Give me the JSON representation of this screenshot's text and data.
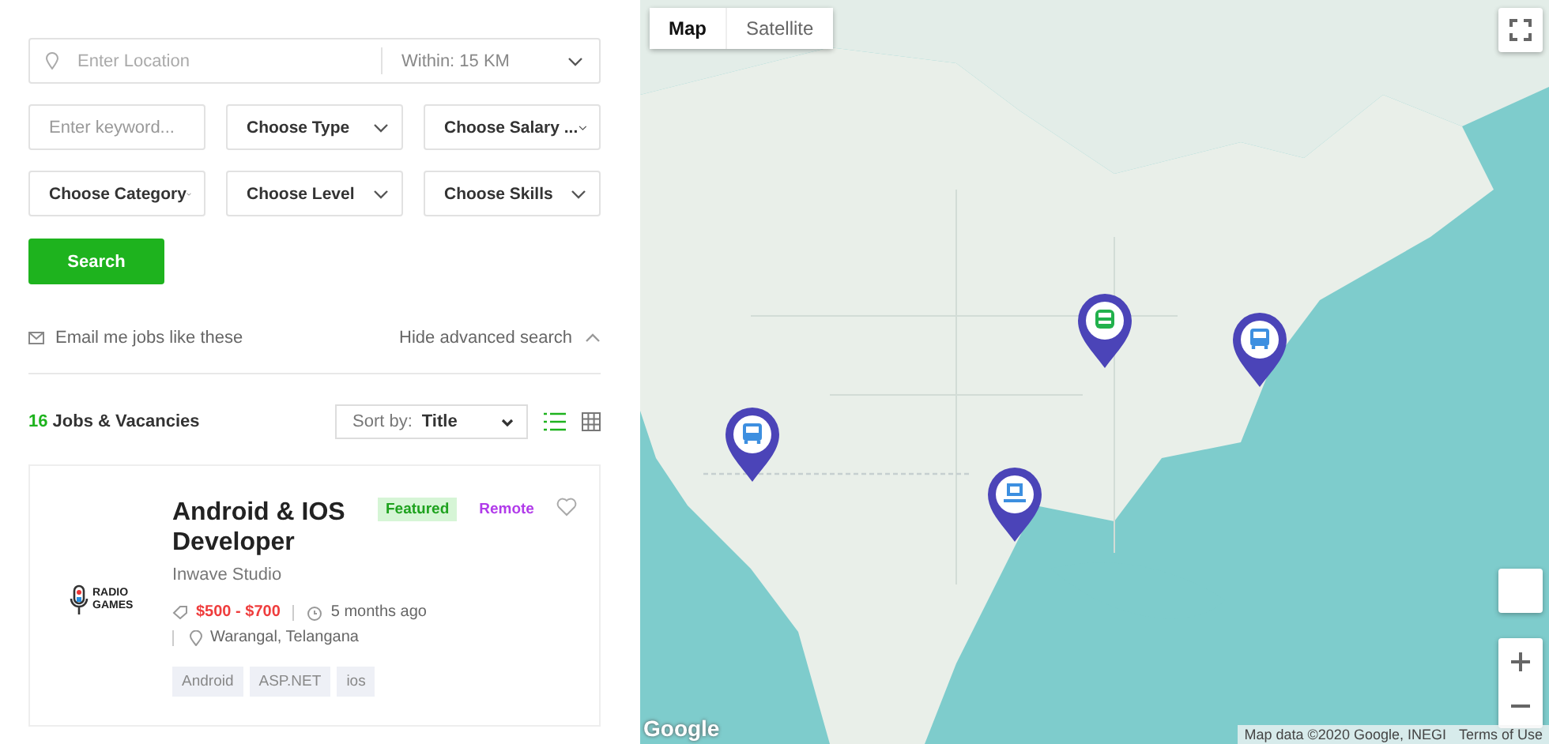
{
  "search": {
    "location": {
      "placeholder": "Enter Location"
    },
    "radius": "Within: 15 KM",
    "keyword": {
      "placeholder": "Enter keyword..."
    },
    "selects": [
      {
        "label": "Choose Type"
      },
      {
        "label": "Choose Salary ..."
      },
      {
        "label": "Choose Category"
      },
      {
        "label": "Choose Level"
      },
      {
        "label": "Choose Skills"
      }
    ],
    "button": "Search",
    "email_alert": "Email me jobs like these",
    "toggle_advanced": "Hide advanced search"
  },
  "results": {
    "count": "16",
    "label": "Jobs & Vacancies",
    "sort_label": "Sort by:",
    "sort_value": "Title",
    "view_toggles": [
      {
        "kind": "list",
        "selected": true
      },
      {
        "kind": "grid",
        "selected": false
      }
    ]
  },
  "jobs": [
    {
      "title": "Android & IOS Developer",
      "company": "Inwave Studio",
      "logo": "RADIO GAMES",
      "featured": "Featured",
      "type": "Remote",
      "salary": "$500 - $700",
      "posted": "5 months ago",
      "location": "Warangal, Telangana",
      "tags": [
        "Android",
        "ASP.NET",
        "ios"
      ]
    }
  ],
  "map": {
    "types": [
      {
        "label": "Map",
        "selected": true
      },
      {
        "label": "Satellite",
        "selected": false
      }
    ],
    "pins": [
      {
        "kind": "bus",
        "color": "#3d8fe0"
      },
      {
        "kind": "train",
        "color": "#22b14c"
      },
      {
        "kind": "bus",
        "color": "#3d8fe0"
      },
      {
        "kind": "laptop",
        "color": "#3d8fe0"
      }
    ],
    "logo": "Google",
    "attribution": "Map data ©2020 Google, INEGI",
    "terms": "Terms of Use"
  }
}
